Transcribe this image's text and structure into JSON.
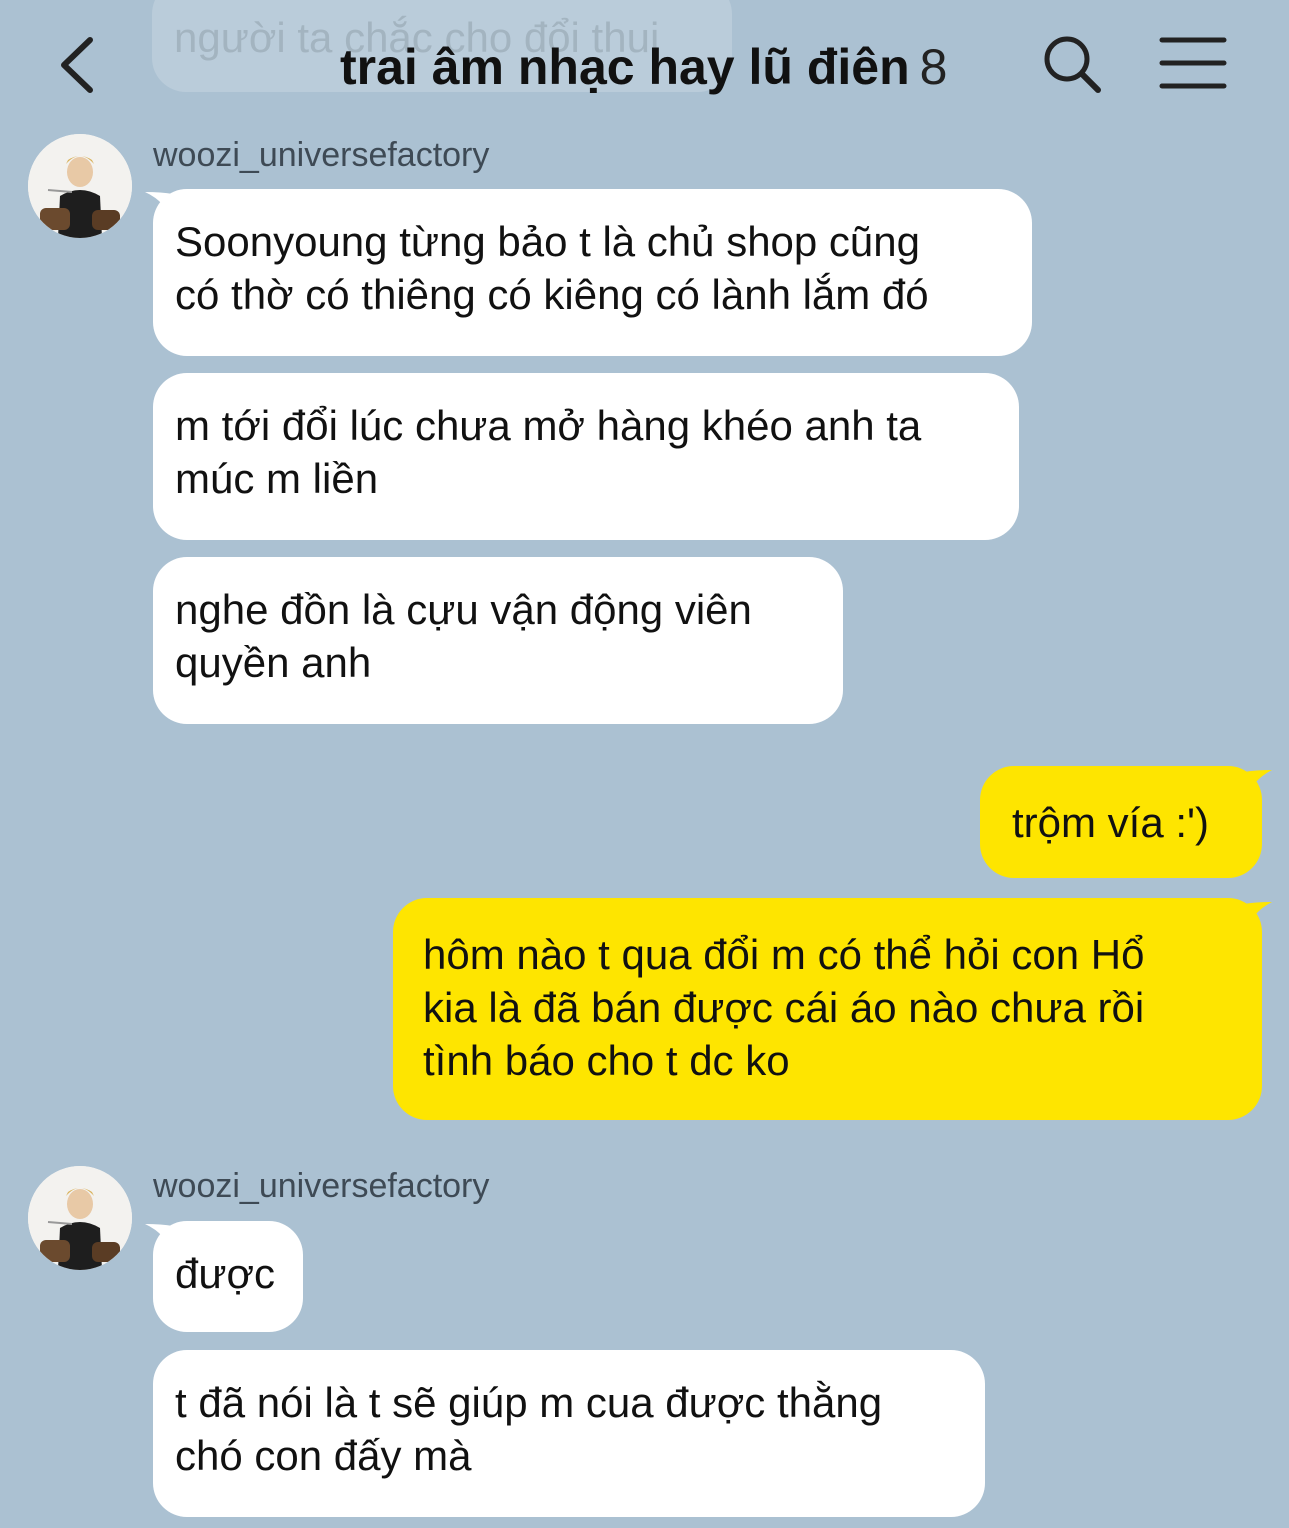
{
  "colors": {
    "background": "#abc1d2",
    "incoming": "#ffffff",
    "outgoing": "#fee500"
  },
  "header": {
    "title": "trai âm nhạc hay lũ điên",
    "member_count": "8",
    "back_icon": "chevron-left-icon",
    "search_icon": "search-icon",
    "menu_icon": "hamburger-menu-icon"
  },
  "previous_message_fragment": "người ta chắc cho đổi thui",
  "groups": [
    {
      "sender": "woozi_universefactory",
      "messages": [
        {
          "lines": [
            "Soonyoung từng bảo t là chủ shop cũng",
            "có thờ có thiêng có kiêng có lành lắm đó"
          ]
        },
        {
          "lines": [
            "m tới đổi lúc chưa mở hàng khéo anh ta",
            "múc m liền"
          ]
        },
        {
          "lines": [
            "nghe đồn là cựu vận động viên",
            "quyền anh"
          ]
        }
      ]
    },
    {
      "sender": "me",
      "messages": [
        {
          "lines": [
            "trộm vía :')"
          ]
        },
        {
          "lines": [
            "hôm nào t qua đổi m có thể hỏi con Hổ",
            "kia là đã bán được cái áo nào chưa rồi",
            "tình báo cho t dc ko"
          ]
        }
      ]
    },
    {
      "sender": "woozi_universefactory",
      "messages": [
        {
          "lines": [
            "được"
          ]
        },
        {
          "lines": [
            "t đã nói là t sẽ giúp m cua được thằng",
            "chó con đấy mà"
          ]
        }
      ]
    }
  ]
}
